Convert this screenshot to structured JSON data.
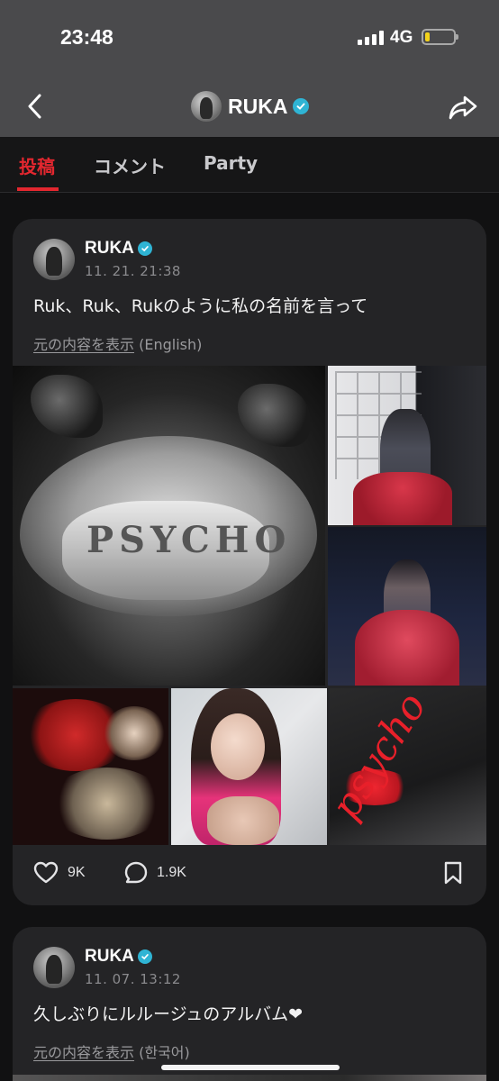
{
  "status_bar": {
    "time": "23:48",
    "network": "4G",
    "battery_level": 0.18,
    "battery_color": "#f2d11a"
  },
  "header": {
    "title": "RUKA",
    "verified": true
  },
  "tabs": [
    {
      "label": "投稿",
      "active": true
    },
    {
      "label": "コメント",
      "active": false
    },
    {
      "label": "Party",
      "active": false
    }
  ],
  "accent_color": "#e3272f",
  "verified_color": "#2fb4d4",
  "posts": [
    {
      "author": "RUKA",
      "date": "11. 21. 21:38",
      "body": "Ruk、Ruk、Rukのように私の名前を言って",
      "translate_link": "元の内容を表示",
      "translate_lang": "(English)",
      "image_text": "PSYCHO",
      "image_text_2": "psycho",
      "likes": "9K",
      "comments": "1.9K"
    },
    {
      "author": "RUKA",
      "date": "11. 07. 13:12",
      "body": "久しぶりにルルージュのアルバム❤",
      "translate_link": "元の内容を表示",
      "translate_lang": "(한국어)"
    }
  ]
}
